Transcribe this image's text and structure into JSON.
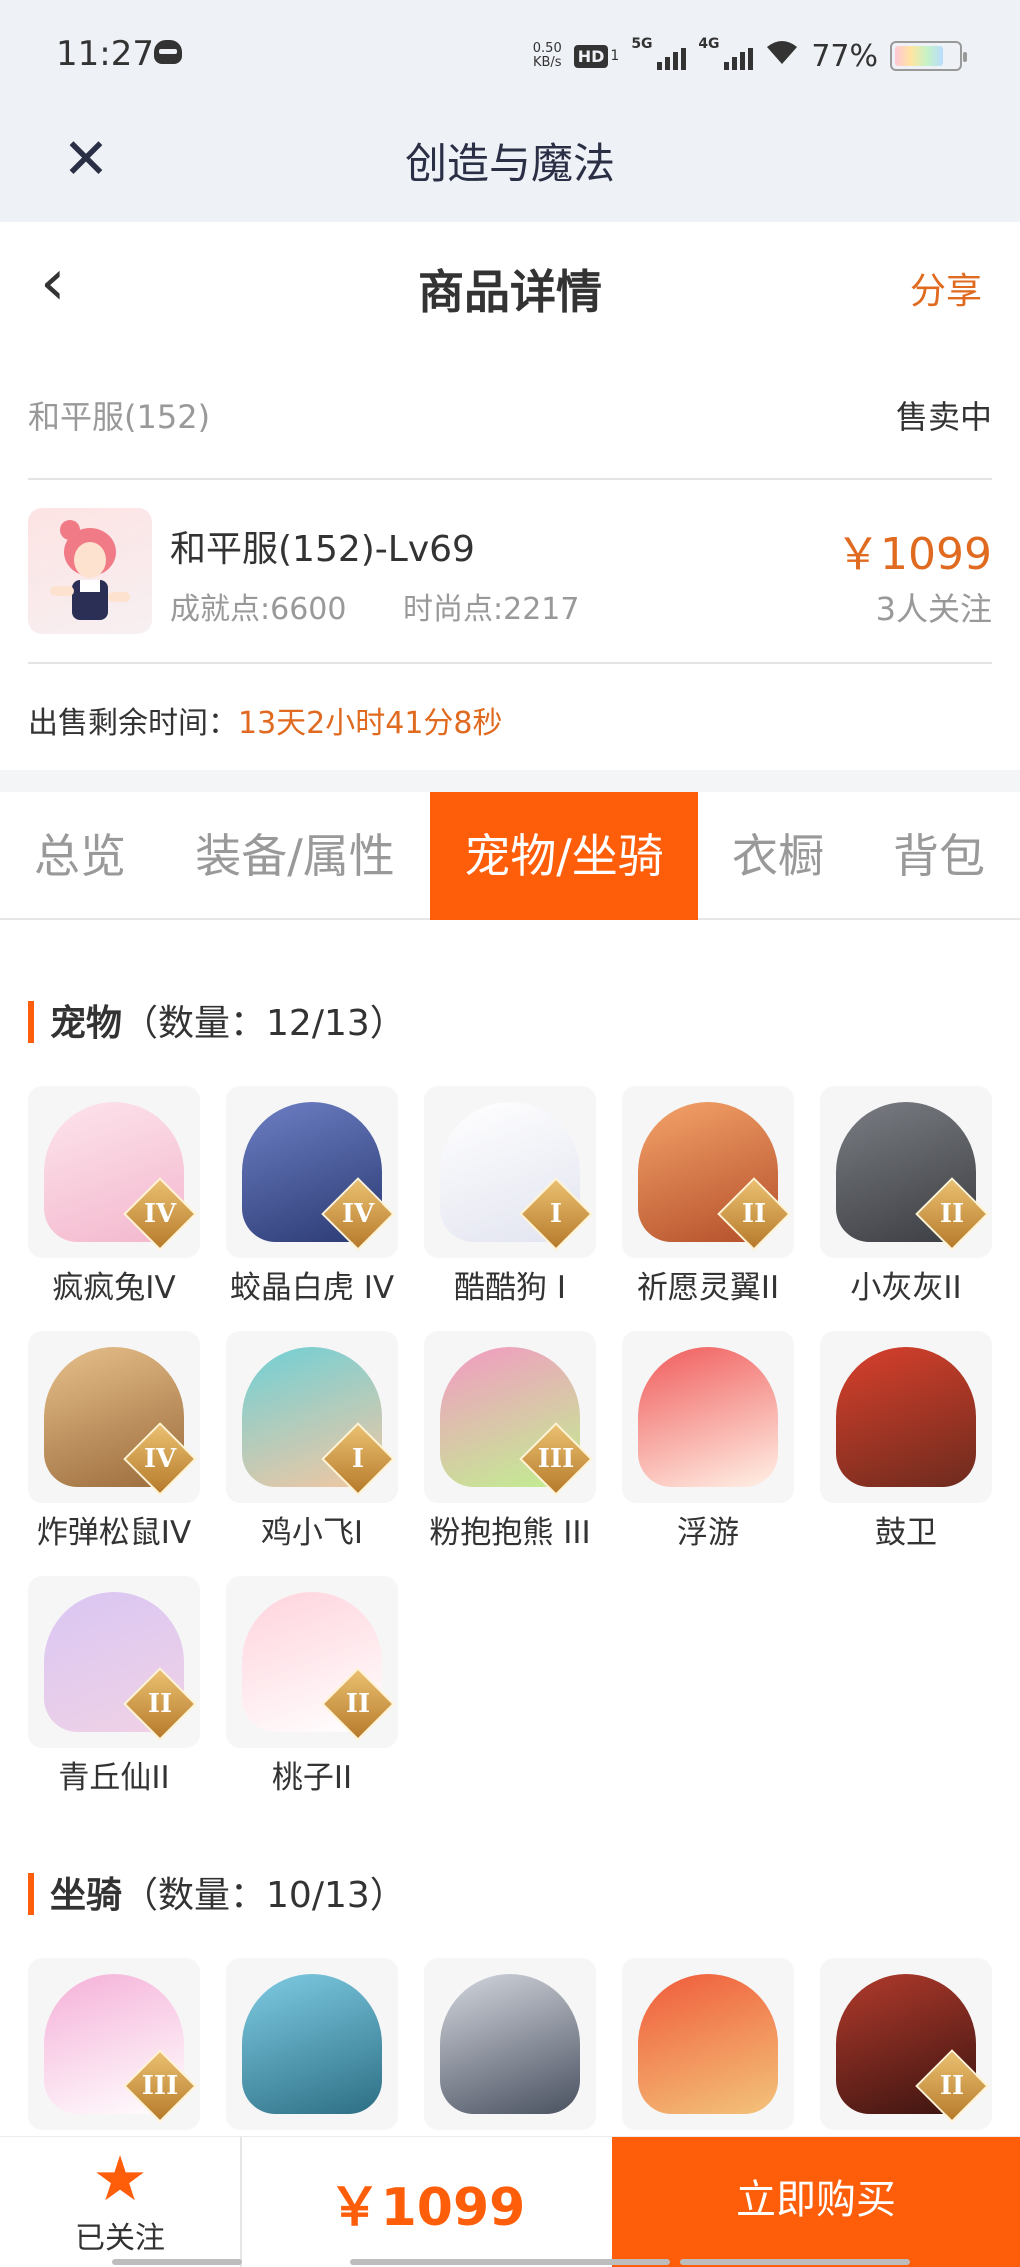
{
  "status_bar": {
    "time": "11:27",
    "speed_value": "0.50",
    "speed_unit": "KB/s",
    "hd_label": "HD",
    "hd_sub": "1",
    "net1": "5G",
    "net2": "4G",
    "battery": "77%"
  },
  "app_bar": {
    "title": "创造与魔法",
    "close_icon": "close-icon"
  },
  "header": {
    "title": "商品详情",
    "share": "分享",
    "back_icon": "chevron-left-icon"
  },
  "listing": {
    "server": "和平服(152)",
    "status": "售卖中",
    "character_name": "和平服(152)-Lv69",
    "achievement": "成就点:6600",
    "fashion": "时尚点:2217",
    "price": "￥1099",
    "followers": "3人关注",
    "remaining_label": "出售剩余时间：",
    "remaining_value": "13天2小时41分8秒"
  },
  "tabs": [
    "总览",
    "装备/属性",
    "宠物/坐骑",
    "衣橱",
    "背包"
  ],
  "active_tab": 2,
  "pets": {
    "title": "宠物",
    "count": "（数量：12/13）",
    "items": [
      {
        "label": "疯疯兔IV",
        "badge": "IV"
      },
      {
        "label": "蛟晶白虎 IV",
        "badge": "IV"
      },
      {
        "label": "酷酷狗 I",
        "badge": "I"
      },
      {
        "label": "祈愿灵翼II",
        "badge": "II"
      },
      {
        "label": "小灰灰II",
        "badge": "II"
      },
      {
        "label": "炸弹松鼠IV",
        "badge": "IV"
      },
      {
        "label": "鸡小飞I",
        "badge": "I"
      },
      {
        "label": "粉抱抱熊 III",
        "badge": "III"
      },
      {
        "label": "浮游",
        "badge": ""
      },
      {
        "label": "鼓卫",
        "badge": ""
      },
      {
        "label": "青丘仙II",
        "badge": "II"
      },
      {
        "label": "桃子II",
        "badge": "II"
      }
    ]
  },
  "mounts": {
    "title": "坐骑",
    "count": "（数量：10/13）",
    "items": [
      {
        "badge": "III"
      },
      {
        "badge": ""
      },
      {
        "badge": ""
      },
      {
        "badge": ""
      },
      {
        "badge": "II"
      }
    ]
  },
  "bottom_bar": {
    "follow_label": "已关注",
    "star_icon": "star-icon",
    "price": "￥1099",
    "buy_label": "立即购买"
  },
  "colors": {
    "accent": "#fe5d0a",
    "accent_text": "#e06a1f"
  }
}
